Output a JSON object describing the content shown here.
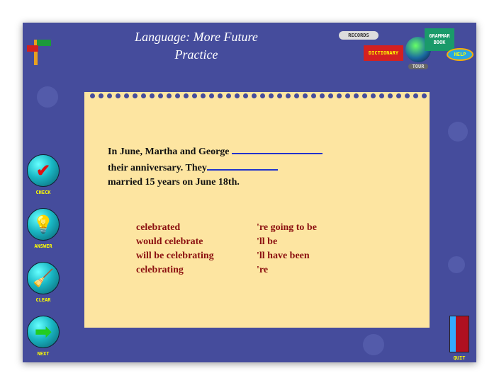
{
  "title": "Language: More Future Practice",
  "toolbar": {
    "records": "RECORDS",
    "dictionary": "DICTIONARY",
    "tour": "TOUR",
    "grammar_book": "GRAMMAR BOOK",
    "help": "HELP"
  },
  "exercise": {
    "line1": "In June, Martha and George ",
    "line2": "their anniversary. They",
    "line3": "married 15 years on June 18th."
  },
  "options_left": [
    "celebrated",
    "would celebrate",
    "will be celebrating",
    "celebrating"
  ],
  "options_right": [
    "'re going to be",
    "'ll be",
    "'ll have been",
    "'re"
  ],
  "side_buttons": {
    "check": "CHECK",
    "answer": "ANSWER",
    "clear": "CLEAR",
    "next": "NEXT"
  },
  "quit": "QUIT",
  "colors": {
    "background": "#454c9c",
    "paper": "#fde5a1",
    "option_text": "#8b1010",
    "blank_line": "#2233cc"
  }
}
